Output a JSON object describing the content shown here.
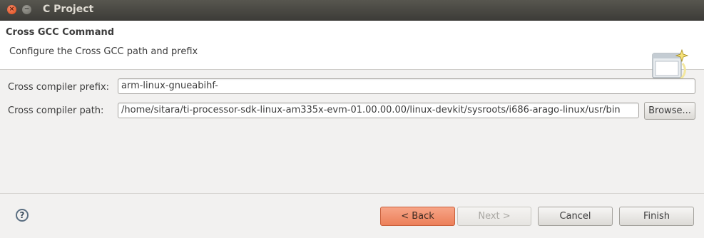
{
  "window": {
    "title": "C Project",
    "close_glyph": "×",
    "minimize_glyph": "−"
  },
  "banner": {
    "title": "Cross GCC Command",
    "description": "Configure the Cross GCC path and prefix",
    "icon": "wizard-banner-icon"
  },
  "form": {
    "prefix_label": "Cross compiler prefix:",
    "prefix_value": "arm-linux-gnueabihf-",
    "path_label": "Cross compiler path:",
    "path_value": "/home/sitara/ti-processor-sdk-linux-am335x-evm-01.00.00.00/linux-devkit/sysroots/i686-arago-linux/usr/bin",
    "browse_label": "Browse..."
  },
  "footer": {
    "help_glyph": "?",
    "back_label": "< Back",
    "next_label": "Next >",
    "cancel_label": "Cancel",
    "finish_label": "Finish"
  },
  "colors": {
    "titlebar": "#3d3c38",
    "accent_button": "#ec7f59",
    "background": "#f2f1f0"
  }
}
